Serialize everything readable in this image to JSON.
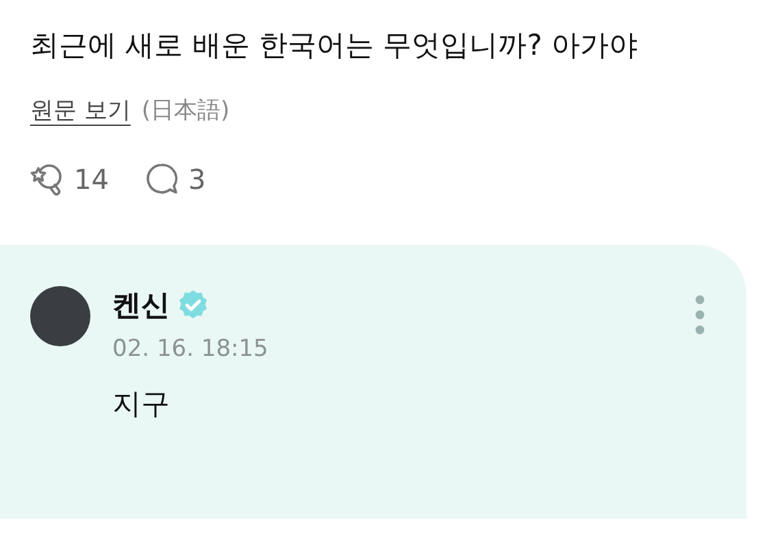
{
  "post": {
    "text": "최근에 새로 배운 한국어는 무엇입니까? 아가야",
    "translate_link": "원문 보기",
    "source_language": "(日本語)"
  },
  "reactions": [
    {
      "kind": "like",
      "count": "14"
    },
    {
      "kind": "comment",
      "count": "3"
    }
  ],
  "reply": {
    "author": "켄신",
    "verified": true,
    "time": "02. 16. 18:15",
    "text": "지구"
  }
}
